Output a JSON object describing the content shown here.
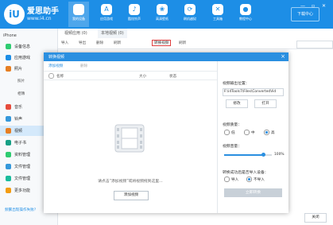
{
  "app": {
    "logo_mark": "iU",
    "title": "爱思助手",
    "url": "www.i4.cn",
    "download_label": "下载中心"
  },
  "nav": [
    {
      "label": "我的设备",
      "icon": "apple-icon",
      "active": true
    },
    {
      "label": "应用游戏",
      "icon": "apps-icon",
      "active": false
    },
    {
      "label": "酷炫铃声",
      "icon": "bell-icon",
      "active": false
    },
    {
      "label": "高清壁纸",
      "icon": "wallpaper-icon",
      "active": false
    },
    {
      "label": "刷机越狱",
      "icon": "flash-icon",
      "active": false
    },
    {
      "label": "工具箱",
      "icon": "toolbox-icon",
      "active": false
    },
    {
      "label": "教程中心",
      "icon": "tutorial-icon",
      "active": false
    }
  ],
  "sidebar": {
    "device_name": "iPhone",
    "items": [
      {
        "label": "设备信息",
        "color": "#2ecc71"
      },
      {
        "label": "应用游戏",
        "color": "#1d8ee6"
      },
      {
        "label": "照片",
        "color": "#e67e22"
      }
    ],
    "sub_items": [
      "照片",
      "相簿"
    ],
    "items2": [
      {
        "label": "音乐",
        "color": "#e74c3c"
      },
      {
        "label": "铃声",
        "color": "#3498db"
      },
      {
        "label": "视频",
        "color": "#e67e22",
        "active": true
      },
      {
        "label": "电子书",
        "color": "#16a085"
      },
      {
        "label": "资料管理",
        "color": "#2ecc71"
      },
      {
        "label": "文件管理",
        "color": "#3498db"
      },
      {
        "label": "文件管理",
        "color": "#1abc9c"
      },
      {
        "label": "更多功能",
        "color": "#f39c12"
      }
    ],
    "footer": "频繁出现操作失败?"
  },
  "main": {
    "tabs": [
      {
        "label": "视频应用 (0)",
        "active": false
      },
      {
        "label": "本地视频 (0)",
        "active": true
      }
    ],
    "toolbar": [
      "导入",
      "导出",
      "删除",
      "刷新"
    ],
    "convert_label": "转换视频",
    "refresh_label": "刷新",
    "close_label": "关闭"
  },
  "modal": {
    "title": "转换视频",
    "add_label": "添加视频",
    "delete_label": "删除",
    "columns": [
      "名称",
      "大小",
      "状态"
    ],
    "empty_message": "请点击“添加视频”或将视频拖到这里…",
    "add_button": "添加视频",
    "output_label": "视频输出位置：",
    "output_path": "F:\\i4Tools7\\Files\\ConvertedVid",
    "browse_label": "修改",
    "open_label": "打开",
    "quality_label": "视频质量：",
    "quality_options": [
      "低",
      "中",
      "高"
    ],
    "quality_selected": 2,
    "volume_label": "视频音量：",
    "volume_value": "100%",
    "volume_fraction": 0.82,
    "import_label": "转换成功后是否导入设备：",
    "import_options": [
      "导入",
      "不导入"
    ],
    "import_selected": 1,
    "start_label": "立即转换"
  }
}
